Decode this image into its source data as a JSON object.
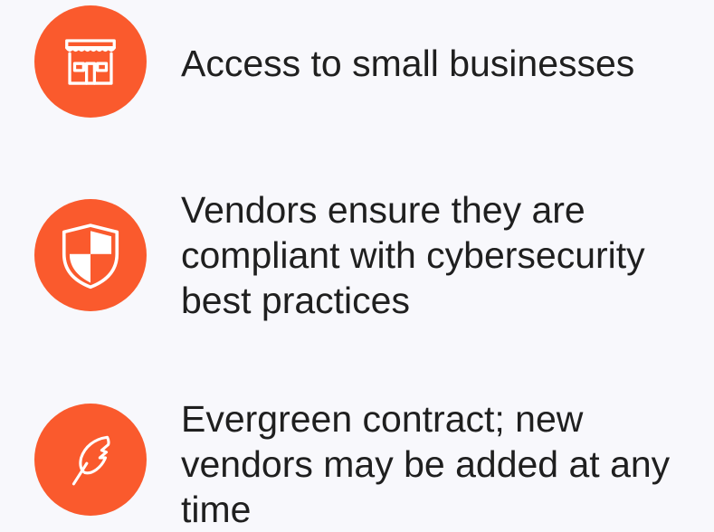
{
  "features": [
    {
      "icon": "storefront-icon",
      "text": "Access to small businesses"
    },
    {
      "icon": "shield-icon",
      "text": "Vendors ensure they are compliant with cybersecurity best practices"
    },
    {
      "icon": "feather-icon",
      "text": "Evergreen contract; new vendors may be added at any time"
    }
  ],
  "colors": {
    "accent": "#fa5a2d",
    "background": "#f8f8fc",
    "text": "#1f1f1f"
  }
}
